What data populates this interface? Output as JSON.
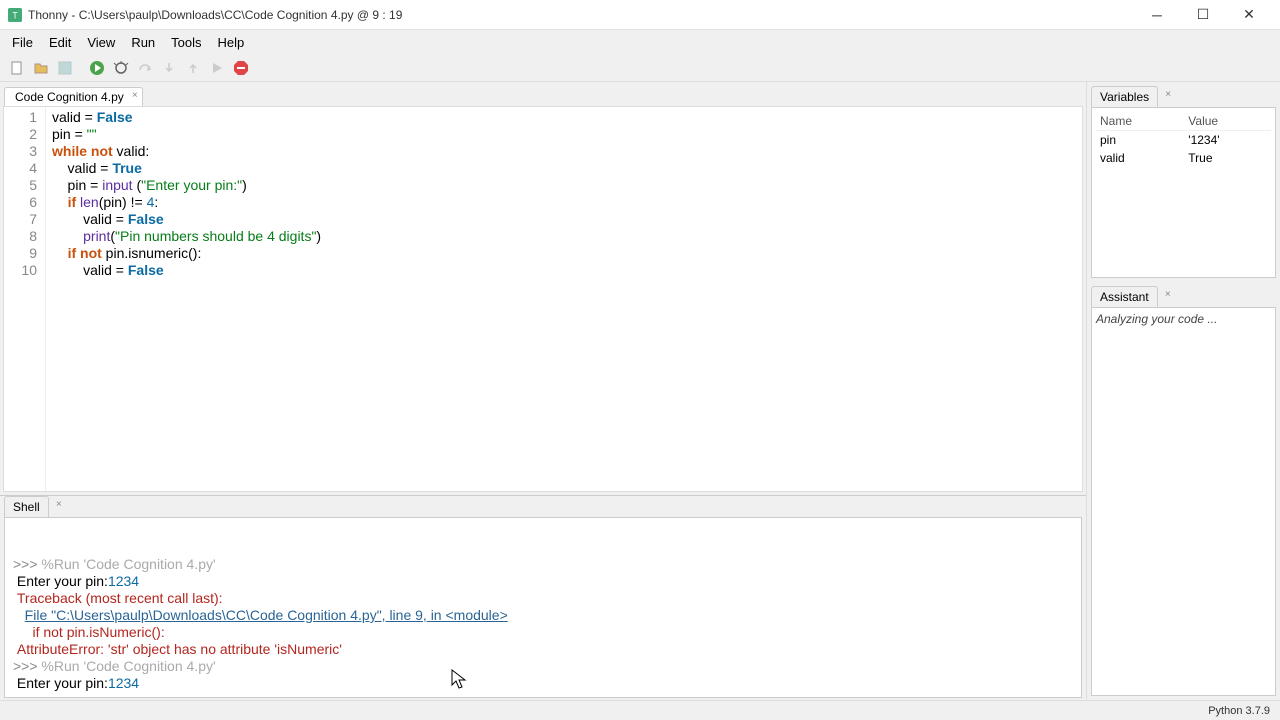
{
  "window": {
    "title": "Thonny  -  C:\\Users\\paulp\\Downloads\\CC\\Code Cognition 4.py  @  9 : 19"
  },
  "menus": [
    "File",
    "Edit",
    "View",
    "Run",
    "Tools",
    "Help"
  ],
  "tab": {
    "label": "Code Cognition 4.py"
  },
  "code_lines": [
    {
      "n": "1",
      "html": "valid = <span class='bool'>False</span>"
    },
    {
      "n": "2",
      "html": "pin = <span class='str'>\"\"</span>"
    },
    {
      "n": "3",
      "html": "<span class='kw'>while</span> <span class='kw'>not</span> valid:"
    },
    {
      "n": "4",
      "html": "    valid = <span class='bool'>True</span>"
    },
    {
      "n": "5",
      "html": "    pin = <span class='fn'>input</span> (<span class='str'>\"Enter your pin:\"</span>)"
    },
    {
      "n": "6",
      "html": "    <span class='kw'>if</span> <span class='fn'>len</span>(pin) != <span class='num'>4</span>:"
    },
    {
      "n": "7",
      "html": "        valid = <span class='bool'>False</span>"
    },
    {
      "n": "8",
      "html": "        <span class='fn'>print</span>(<span class='str'>\"Pin numbers should be 4 digits\"</span>)"
    },
    {
      "n": "9",
      "html": "    <span class='kw'>if</span> <span class='kw'>not</span> pin.isnumeric():"
    },
    {
      "n": "10",
      "html": "        valid = <span class='bool'>False</span>"
    }
  ],
  "shell_title": "Shell",
  "shell_lines": [
    {
      "cls": "",
      "html": "<span class='prompt'>&gt;&gt;&gt;</span> <span class='runcmd'>%Run 'Code Cognition 4.py'</span>"
    },
    {
      "cls": "",
      "html": " Enter your pin:<span class='input-val'>1234</span>"
    },
    {
      "cls": "err",
      "html": " Traceback (most recent call last):"
    },
    {
      "cls": "",
      "html": "   <span class='link'>File \"C:\\Users\\paulp\\Downloads\\CC\\Code Cognition 4.py\", line 9, in &lt;module&gt;</span>"
    },
    {
      "cls": "err",
      "html": "     if not pin.isNumeric():"
    },
    {
      "cls": "err",
      "html": " AttributeError: 'str' object has no attribute 'isNumeric'"
    },
    {
      "cls": "",
      "html": "<span class='prompt'>&gt;&gt;&gt;</span> <span class='runcmd'>%Run 'Code Cognition 4.py'</span>"
    },
    {
      "cls": "",
      "html": " Enter your pin:<span class='input-val'>1234</span>"
    },
    {
      "cls": "",
      "html": "<span class='prompt'>&gt;&gt;&gt;</span> "
    }
  ],
  "variables": {
    "title": "Variables",
    "headers": [
      "Name",
      "Value"
    ],
    "rows": [
      {
        "name": "pin",
        "value": "'1234'"
      },
      {
        "name": "valid",
        "value": "True"
      }
    ]
  },
  "assistant": {
    "title": "Assistant",
    "status": "Analyzing your code ..."
  },
  "status": {
    "python": "Python 3.7.9"
  }
}
